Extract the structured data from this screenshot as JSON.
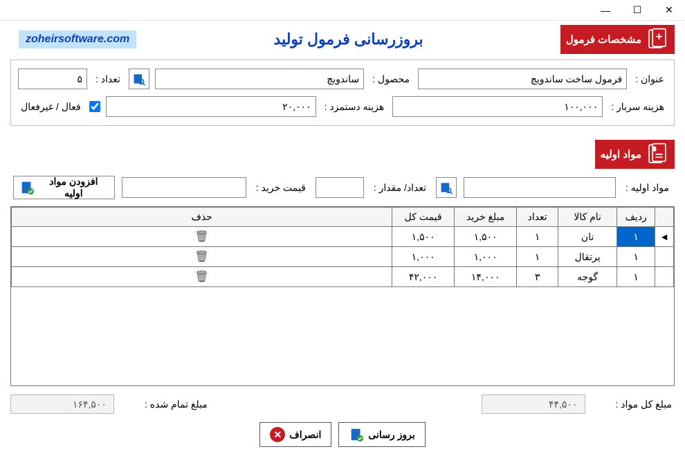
{
  "window": {
    "title": ""
  },
  "brand": "zoheirsoftware.com",
  "page_title": "بروزرسانی فرمول تولید",
  "section1_title": "مشخصات فرمول",
  "section2_title": "مواد اولیه",
  "labels": {
    "title": "عنوان :",
    "product": "محصول :",
    "count": "تعداد :",
    "overhead": "هزینه سربار :",
    "wage": "هزینه دستمزد :",
    "active": "فعال / غیرفعال",
    "material": "مواد اولیه :",
    "qty": "تعداد/ مقدار :",
    "buy_price": "قیمت خرید :",
    "add_material": "افزودن مواد اولیه",
    "total_materials": "مبلغ کل مواد :",
    "final_price": "مبلغ تمام شده :",
    "update": "بروز رسانی",
    "cancel": "انصراف"
  },
  "values": {
    "title": "فرمول ساخت ساندویچ",
    "product": "ساندویچ",
    "count": "۵",
    "overhead": "۱۰۰,۰۰۰",
    "wage": "۲۰,۰۰۰",
    "active": true,
    "material": "",
    "qty": "",
    "buy_price": "",
    "total_materials": "۴۴,۵۰۰",
    "final_price": "۱۶۴,۵۰۰"
  },
  "columns": {
    "row": "ردیف",
    "name": "نام کالا",
    "qty": "تعداد",
    "buy": "مبلغ خرید",
    "total": "قیمت کل",
    "delete": "حذف"
  },
  "rows": [
    {
      "row": "۱",
      "name": "نان",
      "qty": "۱",
      "buy": "۱,۵۰۰",
      "total": "۱,۵۰۰",
      "selected": true
    },
    {
      "row": "۱",
      "name": "پرتقال",
      "qty": "۱",
      "buy": "۱,۰۰۰",
      "total": "۱,۰۰۰",
      "selected": false
    },
    {
      "row": "۱",
      "name": "گوجه",
      "qty": "۳",
      "buy": "۱۴,۰۰۰",
      "total": "۴۲,۰۰۰",
      "selected": false
    }
  ]
}
